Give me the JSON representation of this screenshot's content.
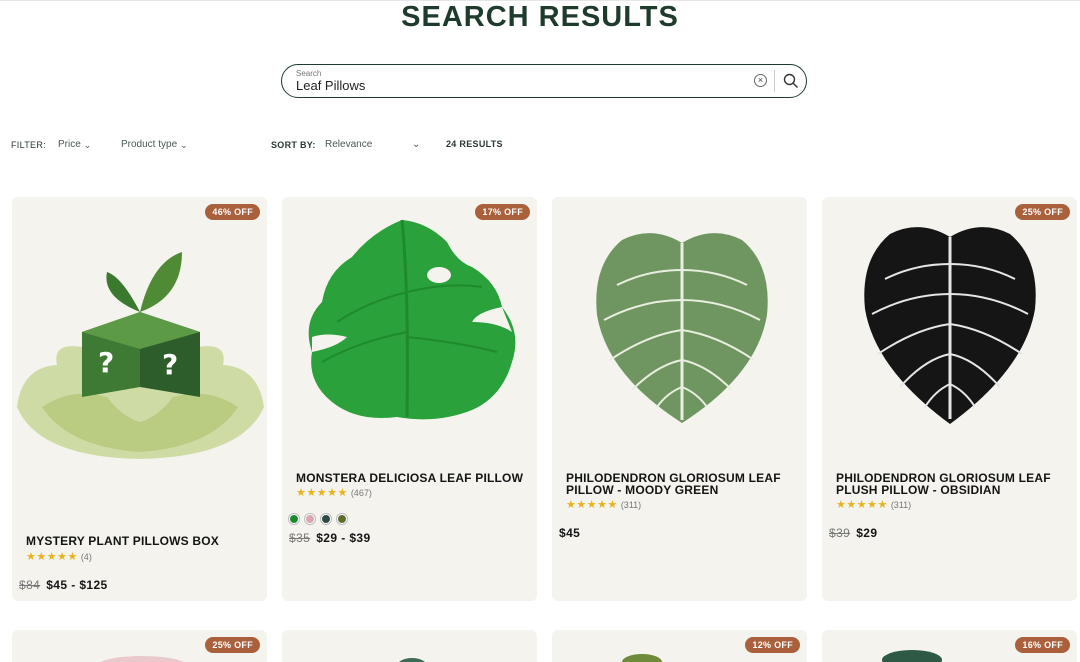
{
  "page": {
    "title": "SEARCH RESULTS"
  },
  "search": {
    "label": "Search",
    "value": "Leaf Pillows",
    "clear_icon": "close-icon",
    "submit_icon": "search-icon"
  },
  "filters": {
    "filter_label": "FILTER:",
    "price_label": "Price",
    "product_type_label": "Product type",
    "sort_label": "SORT BY:",
    "sort_value": "Relevance",
    "results_count": "24 RESULTS"
  },
  "products": [
    {
      "name": "MYSTERY PLANT PILLOWS BOX",
      "badge": "46% OFF",
      "stars": "★★★★★",
      "reviews": "(4)",
      "old_price": "$84",
      "price": "$45 - $125",
      "icon": "mystery-box-image"
    },
    {
      "name": "MONSTERA DELICIOSA LEAF PILLOW",
      "badge": "17% OFF",
      "stars": "★★★★★",
      "reviews": "(467)",
      "old_price": "$35",
      "price": "$29 - $39",
      "icon": "monstera-pillow-image",
      "swatches": [
        "#1e8a2f",
        "#d9a7ad",
        "#2d4b44",
        "#5e6d2d"
      ]
    },
    {
      "name": "PHILODENDRON GLORIOSUM LEAF PILLOW - MOODY GREEN",
      "badge": "",
      "stars": "★★★★★",
      "reviews": "(311)",
      "old_price": "",
      "price": "$45",
      "icon": "green-leaf-pillow-image"
    },
    {
      "name": "PHILODENDRON GLORIOSUM LEAF PLUSH PILLOW - OBSIDIAN",
      "badge": "25% OFF",
      "stars": "★★★★★",
      "reviews": "(311)",
      "old_price": "$39",
      "price": "$29",
      "icon": "black-leaf-pillow-image"
    }
  ],
  "row2_badges": [
    "25% OFF",
    "",
    "12% OFF",
    "16% OFF"
  ],
  "colors": {
    "brand": "#1f3b2c",
    "badge": "#a9603b",
    "card_bg": "#f4f3ee",
    "star": "#e8b21d"
  }
}
